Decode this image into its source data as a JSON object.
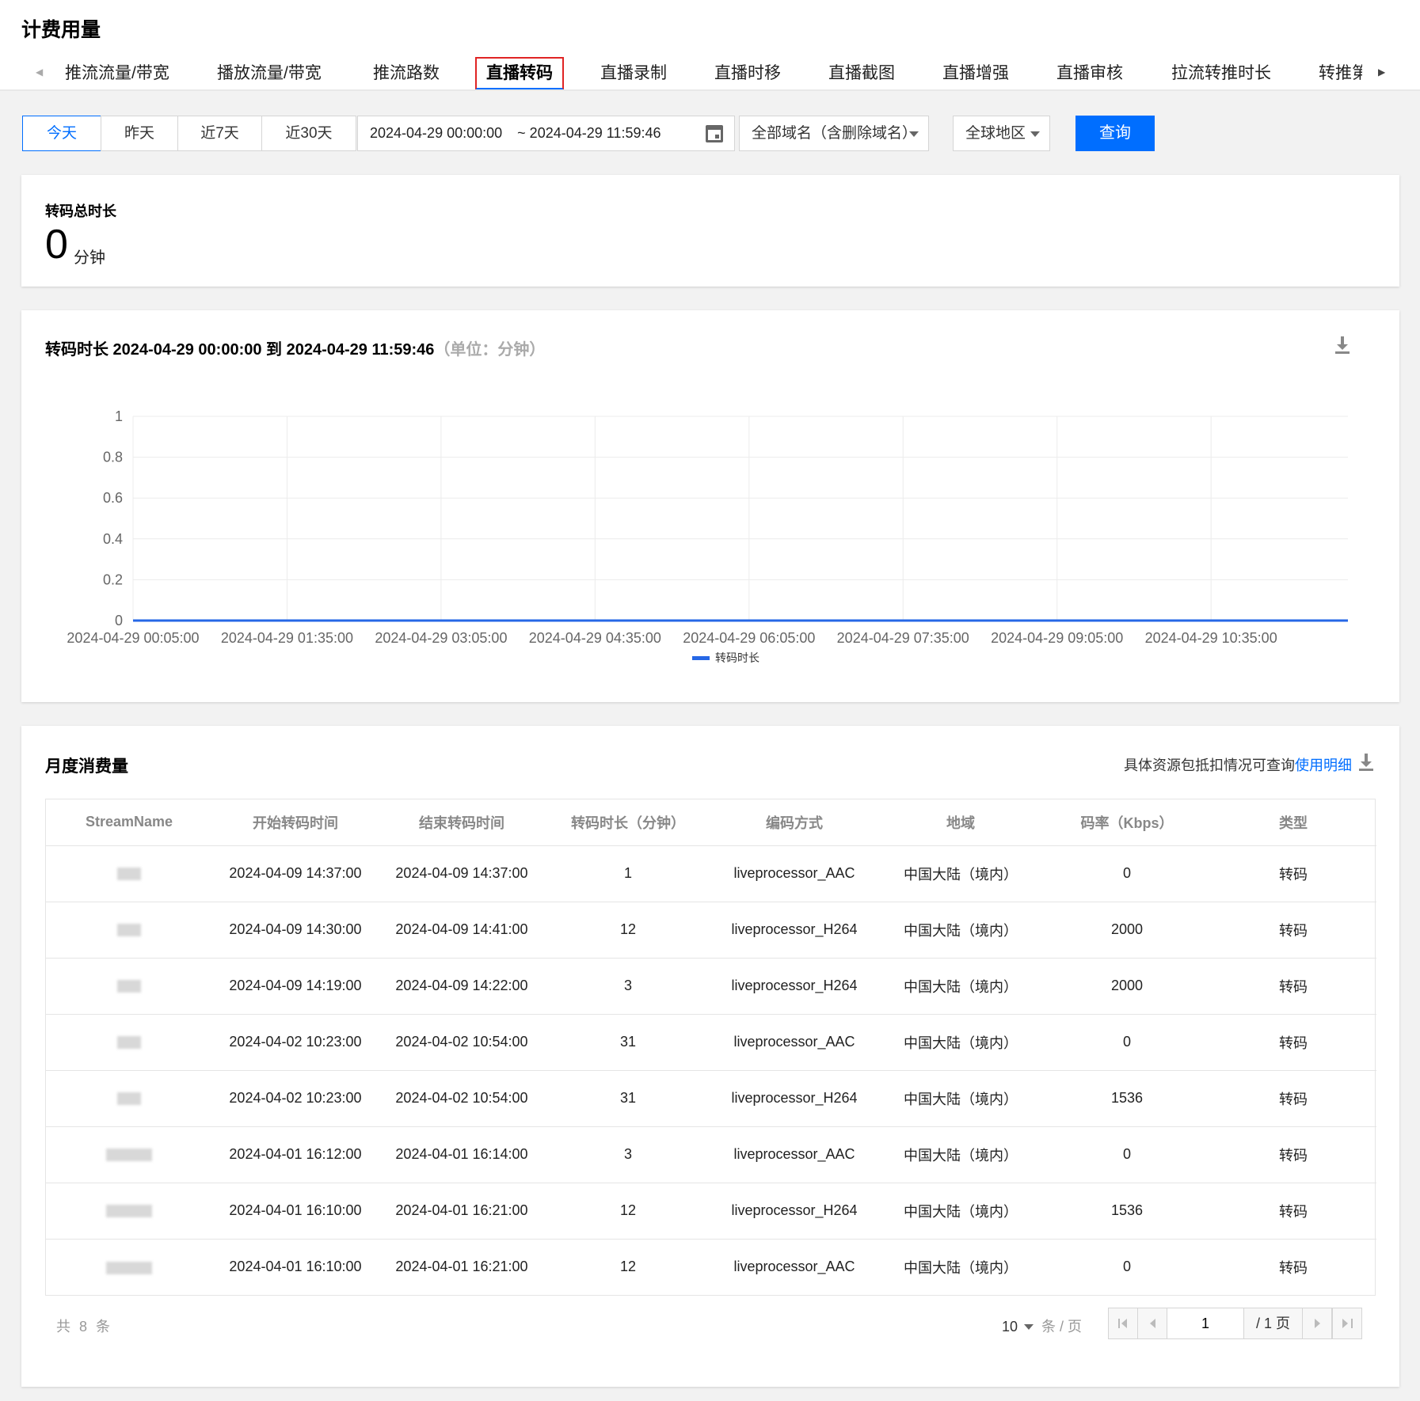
{
  "page_title": "计费用量",
  "tabs": [
    {
      "label": "推流流量/带宽"
    },
    {
      "label": "播放流量/带宽"
    },
    {
      "label": "推流路数"
    },
    {
      "label": "直播转码",
      "active": true
    },
    {
      "label": "直播录制"
    },
    {
      "label": "直播时移"
    },
    {
      "label": "直播截图"
    },
    {
      "label": "直播增强"
    },
    {
      "label": "直播审核"
    },
    {
      "label": "拉流转推时长"
    },
    {
      "label": "转推第"
    }
  ],
  "filters": {
    "quick_ranges": [
      "今天",
      "昨天",
      "近7天",
      "近30天"
    ],
    "active_range": "今天",
    "date_start": "2024-04-29 00:00:00",
    "date_end": "~ 2024-04-29 11:59:46",
    "domain_select": "全部域名（含删除域名）",
    "region_select": "全球地区",
    "query_button": "查询"
  },
  "summary": {
    "label": "转码总时长",
    "value": "0",
    "unit": "分钟"
  },
  "chart": {
    "title": "转码时长 2024-04-29 00:00:00 到 2024-04-29 11:59:46",
    "subtitle": "（单位：分钟）"
  },
  "chart_data": {
    "type": "line",
    "title": "转码时长 2024-04-29 00:00:00 到 2024-04-29 11:59:46",
    "x_tick_labels": [
      "2024-04-29 00:05:00",
      "2024-04-29 01:35:00",
      "2024-04-29 03:05:00",
      "2024-04-29 04:35:00",
      "2024-04-29 06:05:00",
      "2024-04-29 07:35:00",
      "2024-04-29 09:05:00",
      "2024-04-29 10:35:00"
    ],
    "y_tick_labels": [
      "0",
      "0.2",
      "0.4",
      "0.6",
      "0.8",
      "1"
    ],
    "ylim": [
      0,
      1
    ],
    "xlim": [
      "2024-04-29 00:05:00",
      "2024-04-29 11:55:00"
    ],
    "series": [
      {
        "name": "转码时长",
        "color": "#2667e6",
        "x": [
          "2024-04-29 00:05:00",
          "2024-04-29 11:55:00"
        ],
        "values": [
          0,
          0
        ]
      }
    ],
    "legend": "bottom-center",
    "grid": true
  },
  "monthly": {
    "title": "月度消费量",
    "hint": "具体资源包抵扣情况可查询",
    "hint_link": "使用明细",
    "columns": [
      "StreamName",
      "开始转码时间",
      "结束转码时间",
      "转码时长（分钟）",
      "编码方式",
      "地域",
      "码率（Kbps）",
      "类型"
    ],
    "rows": [
      [
        "2024-04-09 14:37:00",
        "2024-04-09 14:37:00",
        "1",
        "liveprocessor_AAC",
        "中国大陆（境内）",
        "0",
        "转码"
      ],
      [
        "2024-04-09 14:30:00",
        "2024-04-09 14:41:00",
        "12",
        "liveprocessor_H264",
        "中国大陆（境内）",
        "2000",
        "转码"
      ],
      [
        "2024-04-09 14:19:00",
        "2024-04-09 14:22:00",
        "3",
        "liveprocessor_H264",
        "中国大陆（境内）",
        "2000",
        "转码"
      ],
      [
        "2024-04-02 10:23:00",
        "2024-04-02 10:54:00",
        "31",
        "liveprocessor_AAC",
        "中国大陆（境内）",
        "0",
        "转码"
      ],
      [
        "2024-04-02 10:23:00",
        "2024-04-02 10:54:00",
        "31",
        "liveprocessor_H264",
        "中国大陆（境内）",
        "1536",
        "转码"
      ],
      [
        "2024-04-01 16:12:00",
        "2024-04-01 16:14:00",
        "3",
        "liveprocessor_AAC",
        "中国大陆（境内）",
        "0",
        "转码"
      ],
      [
        "2024-04-01 16:10:00",
        "2024-04-01 16:21:00",
        "12",
        "liveprocessor_H264",
        "中国大陆（境内）",
        "1536",
        "转码"
      ],
      [
        "2024-04-01 16:10:00",
        "2024-04-01 16:21:00",
        "12",
        "liveprocessor_AAC",
        "中国大陆（境内）",
        "0",
        "转码"
      ]
    ],
    "total": "共 8 条",
    "page_size": "10",
    "page_size_unit": "条 / 页",
    "current_page": "1",
    "total_pages": "/ 1 页"
  },
  "colors": {
    "primary": "#006eff",
    "active_tab_outline": "#e02424",
    "series": "#2667e6"
  }
}
